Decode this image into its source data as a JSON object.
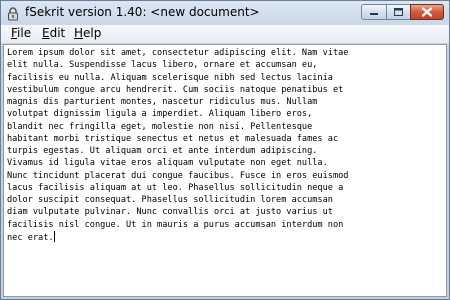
{
  "window": {
    "title": "fSekrit version 1.40: <new document>",
    "icon": "padlock-icon"
  },
  "caption_buttons": {
    "minimize": "minimize-icon",
    "maximize": "maximize-icon",
    "close": "close-icon",
    "close_color": "#c8462c"
  },
  "menu": {
    "file": {
      "hotkey": "F",
      "rest": "ile"
    },
    "edit": {
      "hotkey": "E",
      "rest": "dit"
    },
    "help": {
      "hotkey": "H",
      "rest": "elp"
    }
  },
  "editor": {
    "lines": [
      "Lorem ipsum dolor sit amet, consectetur adipiscing elit. Nam vitae",
      "elit nulla. Suspendisse lacus libero, ornare et accumsan eu,",
      "facilisis eu nulla. Aliquam scelerisque nibh sed lectus lacinia",
      "vestibulum congue arcu hendrerit. Cum sociis natoque penatibus et",
      "magnis dis parturient montes, nascetur ridiculus mus. Nullam",
      "volutpat dignissim ligula a imperdiet. Aliquam libero eros,",
      "blandit nec fringilla eget, molestie non nisi. Pellentesque",
      "habitant morbi tristique senectus et netus et malesuada fames ac",
      "turpis egestas. Ut aliquam orci et ante interdum adipiscing.",
      "Vivamus id ligula vitae eros aliquam vulputate non eget nulla.",
      "Nunc tincidunt placerat dui congue faucibus. Fusce in eros euismod",
      "lacus facilisis aliquam at ut leo. Phasellus sollicitudin neque a",
      "dolor suscipit consequat. Phasellus sollicitudin lorem accumsan",
      "diam vulputate pulvinar. Nunc convallis orci at justo varius ut",
      "facilisis nisl congue. Ut in mauris a purus accumsan interdum non",
      "nec erat."
    ]
  }
}
